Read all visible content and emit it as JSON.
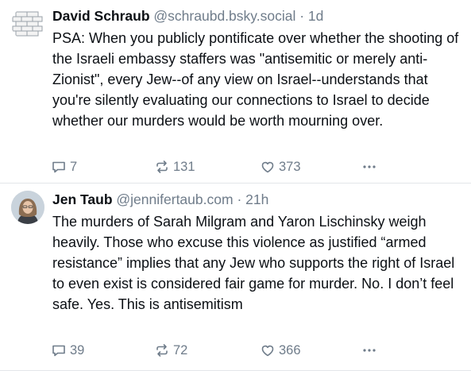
{
  "posts": [
    {
      "author_name": "David Schraub",
      "handle": "@schraubd.bsky.social",
      "separator": "·",
      "time": "1d",
      "text": "PSA: When you publicly pontificate over whether the shooting of the Israeli embassy staffers was \"antisemitic or merely anti-Zionist\", every Jew--of any view on Israel--understands that you're silently evaluating our connections to Israel to decide whether our murders would be worth mourning over.",
      "replies": "7",
      "reposts": "131",
      "likes": "373",
      "avatar_icon": "brick-wall-avatar"
    },
    {
      "author_name": "Jen Taub",
      "handle": "@jennifertaub.com",
      "separator": "·",
      "time": "21h",
      "text": "The murders of Sarah Milgram and Yaron Lischinsky weigh heavily. Those who excuse this violence as justified “armed resistance” implies that any Jew who supports the right of Israel to even exist is considered fair game for murder. No. I don’t feel safe. Yes. This is antisemitism",
      "replies": "39",
      "reposts": "72",
      "likes": "366",
      "avatar_icon": "profile-photo-avatar"
    }
  ],
  "colors": {
    "text": "#0b0f14",
    "muted": "#6f7c8a",
    "divider": "#e3e6ea",
    "background": "#ffffff"
  }
}
